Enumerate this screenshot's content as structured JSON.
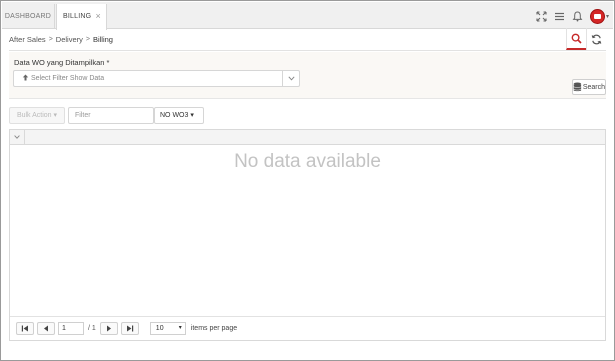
{
  "tabs": [
    {
      "label": "DASHBOARD"
    },
    {
      "label": "BILLING",
      "close": "×"
    }
  ],
  "breadcrumb": {
    "items": [
      "After Sales",
      "Delivery",
      "Billing"
    ],
    "separator": ">"
  },
  "filter": {
    "label": "Data WO yang Ditampilkan *",
    "placeholder": "Select Filter Show Data",
    "search_label": "Search"
  },
  "toolbar": {
    "bulk_action_label": "Bulk Action",
    "bulk_action_caret": "▾",
    "filter_placeholder": "Filter",
    "column_select": "NO WO3",
    "column_caret": "▾"
  },
  "grid": {
    "empty_message": "No data available"
  },
  "pager": {
    "page": "1",
    "of_label": "/ 1",
    "page_size": "10",
    "page_size_caret": "▾",
    "items_per_page_label": "items per page"
  },
  "colors": {
    "accent": "#c62828",
    "avatar": "#d42626"
  },
  "icons": [
    "expand-icon",
    "menu-icon",
    "bell-icon",
    "user-avatar",
    "search-icon",
    "refresh-icon",
    "database-icon",
    "upload-icon",
    "first-page-icon",
    "prev-page-icon",
    "next-page-icon",
    "last-page-icon"
  ]
}
